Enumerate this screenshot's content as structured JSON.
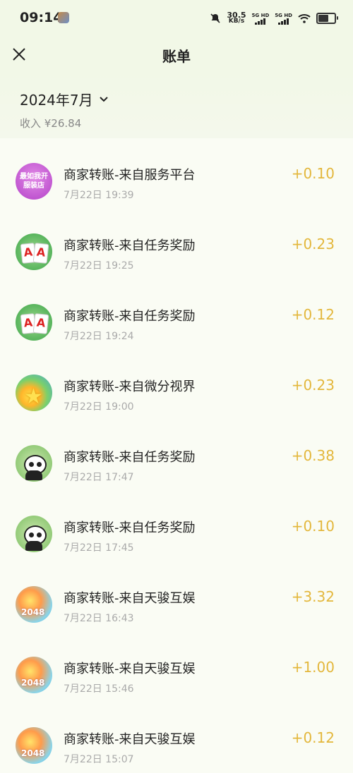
{
  "status_bar": {
    "time": "09:14",
    "net_speed": "30.5",
    "net_unit": "KB/s",
    "sim1": "5G HD",
    "sim2": "5G HD"
  },
  "header": {
    "title": "账单"
  },
  "summary": {
    "month": "2024年7月",
    "income": "收入 ¥26.84"
  },
  "transactions": [
    {
      "icon": "shop-game-icon",
      "title": "商家转账-来自服务平台",
      "time": "7月22日 19:39",
      "amount": "+0.10",
      "icon_text_1": "最如我开",
      "icon_text_2": "服装店"
    },
    {
      "icon": "card-game-icon",
      "title": "商家转账-来自任务奖励",
      "time": "7月22日 19:25",
      "amount": "+0.23"
    },
    {
      "icon": "card-game-icon",
      "title": "商家转账-来自任务奖励",
      "time": "7月22日 19:24",
      "amount": "+0.12"
    },
    {
      "icon": "gem-game-icon",
      "title": "商家转账-来自微分视界",
      "time": "7月22日 19:00",
      "amount": "+0.23"
    },
    {
      "icon": "panda-game-icon",
      "title": "商家转账-来自任务奖励",
      "time": "7月22日 17:47",
      "amount": "+0.38"
    },
    {
      "icon": "panda-game-icon",
      "title": "商家转账-来自任务奖励",
      "time": "7月22日 17:45",
      "amount": "+0.10"
    },
    {
      "icon": "2048-game-icon",
      "title": "商家转账-来自天骏互娱",
      "time": "7月22日 16:43",
      "amount": "+3.32",
      "icon_text": "2048"
    },
    {
      "icon": "2048-game-icon",
      "title": "商家转账-来自天骏互娱",
      "time": "7月22日 15:46",
      "amount": "+1.00",
      "icon_text": "2048"
    },
    {
      "icon": "2048-game-icon",
      "title": "商家转账-来自天骏互娱",
      "time": "7月22日 15:07",
      "amount": "+0.12",
      "icon_text": "2048"
    }
  ],
  "colors": {
    "amount": "#e3b73c",
    "header_bg": "#f2f8e7",
    "page_bg": "#fafcf4"
  }
}
